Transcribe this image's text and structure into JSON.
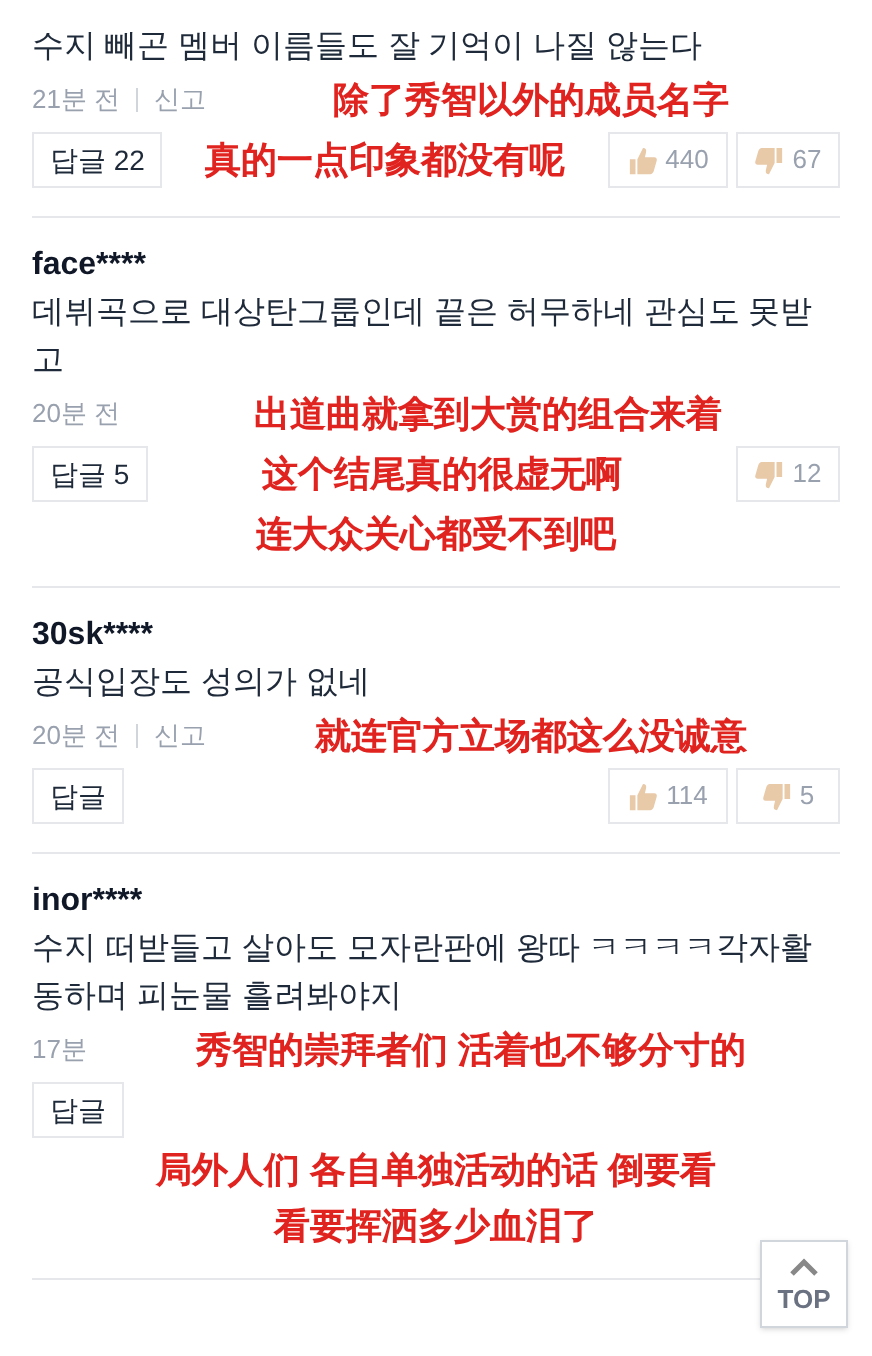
{
  "comments": [
    {
      "body": "수지 빼곤 멤버 이름들도 잘 기억이 나질 않는다",
      "time": "21분 전",
      "report": "신고",
      "reply": "답글 22",
      "likes": "440",
      "dislikes": "67",
      "caption": [
        "除了秀智以外的成员名字",
        "真的一点印象都没有呢"
      ]
    },
    {
      "author": "face****",
      "body": "데뷔곡으로 대상탄그룹인데 끝은 허무하네 관심도 못받고",
      "time": "20분 전",
      "reply": "답글 5",
      "dislikes": "12",
      "caption": [
        "出道曲就拿到大赏的组合来着",
        "这个结尾真的很虚无啊",
        "连大众关心都受不到吧"
      ]
    },
    {
      "author": "30sk****",
      "body": "공식입장도 성의가 없네",
      "time": "20분 전",
      "report": "신고",
      "reply": "답글",
      "likes": "114",
      "dislikes": "5",
      "caption": [
        "就连官方立场都这么没诚意"
      ]
    },
    {
      "author": "inor****",
      "body": "수지 떠받들고 살아도 모자란판에 왕따 ㅋㅋㅋㅋ각자활동하며 피눈물 흘려봐야지",
      "time": "17분",
      "reply": "답글",
      "caption": [
        "秀智的崇拜者们 活着也不够分寸的",
        "局外人们 各自单独活动的话 倒要看",
        "看要挥洒多少血泪了"
      ]
    }
  ],
  "top_button": {
    "label": "TOP"
  }
}
